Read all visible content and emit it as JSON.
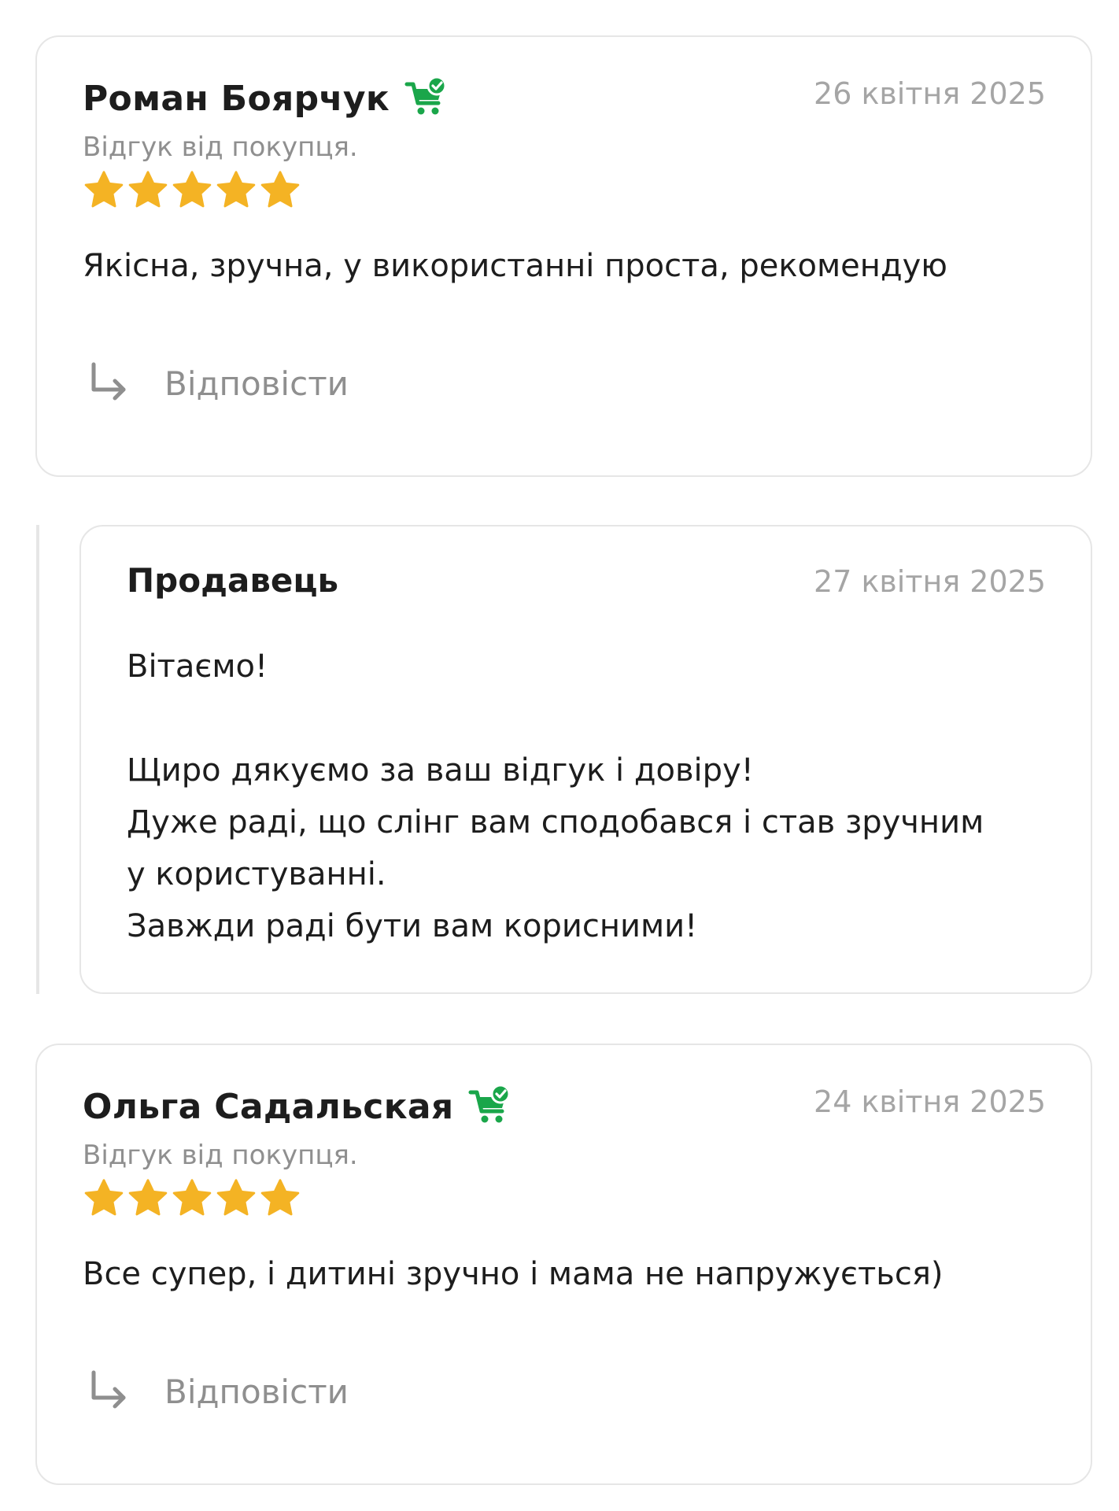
{
  "colors": {
    "star": "#f4b324",
    "buyer_badge": "#1aa64a",
    "muted_text": "#a5a5a5",
    "border": "#e6e6e6"
  },
  "reviews": [
    {
      "author": "Роман Боярчук",
      "badge_icon": "buyer-cart-check-icon",
      "date": "26 квітня 2025",
      "subtitle": "Відгук від покупця.",
      "rating": 5,
      "text": "Якісна, зручна, у використанні проста, рекомендую",
      "reply_label": "Відповісти"
    },
    {
      "author": "Ольга Садальская",
      "badge_icon": "buyer-cart-check-icon",
      "date": "24 квітня 2025",
      "subtitle": "Відгук від покупця.",
      "rating": 5,
      "text": "Все супер, і дитині зручно і мама не напружується)",
      "reply_label": "Відповісти"
    }
  ],
  "seller_reply": {
    "author": "Продавець",
    "date": "27 квітня 2025",
    "lines": [
      "Вітаємо!",
      "",
      "Щиро дякуємо за ваш відгук і довіру!",
      "Дуже раді, що слінг вам сподобався і став зручним",
      "у користуванні.",
      "Завжди раді бути вам корисними!"
    ]
  }
}
